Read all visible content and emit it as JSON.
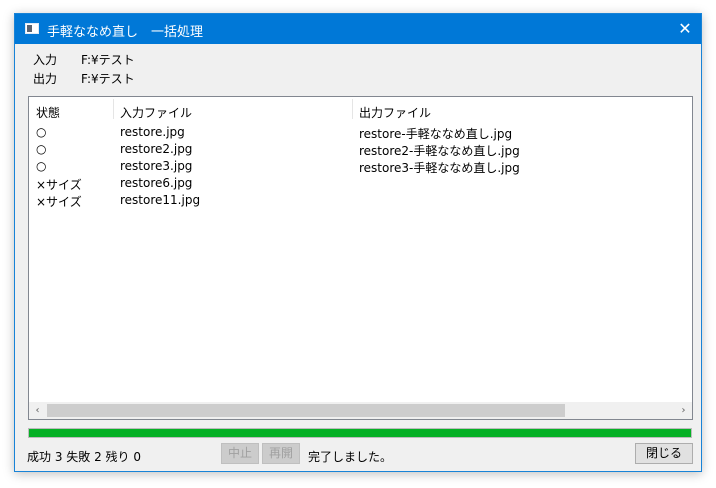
{
  "window": {
    "title": "手軽ななめ直し　一括処理",
    "close": "✕"
  },
  "info": {
    "input_label": "入力",
    "input_value": "F:¥テスト",
    "output_label": "出力",
    "output_value": "F:¥テスト"
  },
  "list": {
    "columns": [
      "状態",
      "入力ファイル",
      "出力ファイル"
    ],
    "rows": [
      {
        "state": "○",
        "input": "restore.jpg",
        "output": "restore-手軽ななめ直し.jpg"
      },
      {
        "state": "○",
        "input": "restore2.jpg",
        "output": "restore2-手軽ななめ直し.jpg"
      },
      {
        "state": "○",
        "input": "restore3.jpg",
        "output": "restore3-手軽ななめ直し.jpg"
      },
      {
        "state": "×サイズ",
        "input": "restore6.jpg",
        "output": ""
      },
      {
        "state": "×サイズ",
        "input": "restore11.jpg",
        "output": ""
      }
    ],
    "scroll_left": "‹",
    "scroll_right": "›"
  },
  "progress": {
    "fraction": 1.0,
    "color": "#06b025"
  },
  "footer": {
    "counts": "成功 3  失敗 2  残り 0",
    "stop_label": "中止",
    "resume_label": "再開",
    "message": "完了しました。",
    "close_label": "閉じる"
  }
}
